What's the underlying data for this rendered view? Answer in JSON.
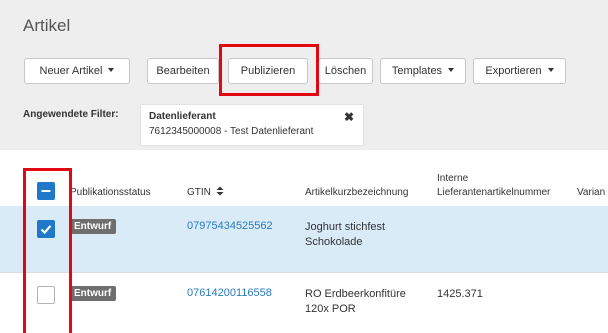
{
  "page": {
    "title": "Artikel"
  },
  "toolbar": {
    "new_article": "Neuer Artikel",
    "edit": "Bearbeiten",
    "publish": "Publizieren",
    "delete": "Löschen",
    "templates": "Templates",
    "export": "Exportieren"
  },
  "filters": {
    "label": "Angewendete Filter:",
    "chip_title": "Datenlieferant",
    "chip_value": "7612345000008 - Test Datenlieferant",
    "close_icon": "close-icon"
  },
  "table": {
    "headers": {
      "status": "Publikationsstatus",
      "gtin": "GTIN",
      "short_desc": "Artikelkurzbezeichnung",
      "internal_line1": "Interne",
      "internal_line2": "Lieferantenartikelnummer",
      "variant": "Varian"
    },
    "rows": [
      {
        "selected": true,
        "status": "Entwurf",
        "gtin": "07975434525562",
        "desc_line1": "Joghurt stichfest",
        "desc_line2": "Schokolade",
        "internal": ""
      },
      {
        "selected": false,
        "status": "Entwurf",
        "gtin": "07614200116558",
        "desc_line1": "RO Erdbeerkonfitüre",
        "desc_line2": "120x POR",
        "internal": "1425.371"
      }
    ]
  },
  "colors": {
    "accent": "#1f78c8",
    "highlight": "#e30613",
    "selected_row": "#d9ebf7",
    "badge": "#6e6e6e"
  }
}
